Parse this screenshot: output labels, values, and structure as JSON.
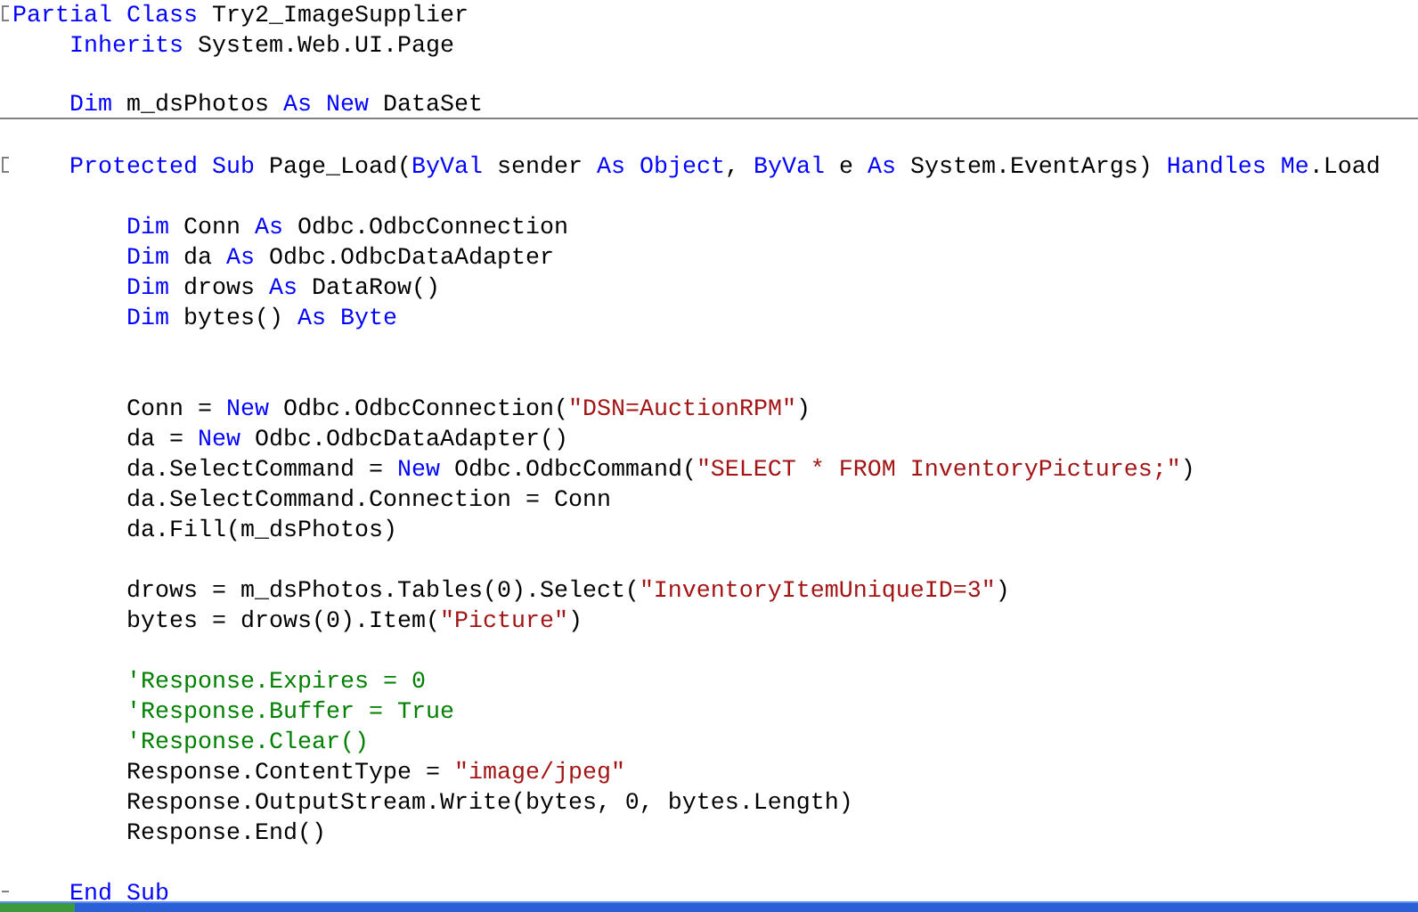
{
  "editor": {
    "lines": [
      {
        "collapsible": true,
        "tokens": [
          {
            "kind": "keyword",
            "text": "Partial Class"
          },
          {
            "kind": "plain",
            "text": " Try2_ImageSupplier"
          }
        ],
        "children": [
          {
            "tokens": [
              {
                "kind": "keyword",
                "text": "Inherits"
              },
              {
                "kind": "plain",
                "text": " System.Web.UI.Page"
              }
            ]
          },
          {
            "blank": true
          },
          {
            "separator_below": true,
            "tokens": [
              {
                "kind": "keyword",
                "text": "Dim"
              },
              {
                "kind": "plain",
                "text": " m_dsPhotos "
              },
              {
                "kind": "keyword",
                "text": "As New"
              },
              {
                "kind": "plain",
                "text": " DataSet"
              }
            ]
          },
          {
            "blank": true
          },
          {
            "collapsible": true,
            "tokens": [
              {
                "kind": "keyword",
                "text": "Protected Sub"
              },
              {
                "kind": "plain",
                "text": " Page_Load("
              },
              {
                "kind": "keyword",
                "text": "ByVal"
              },
              {
                "kind": "plain",
                "text": " sender "
              },
              {
                "kind": "keyword",
                "text": "As Object"
              },
              {
                "kind": "plain",
                "text": ", "
              },
              {
                "kind": "keyword",
                "text": "ByVal"
              },
              {
                "kind": "plain",
                "text": " e "
              },
              {
                "kind": "keyword",
                "text": "As"
              },
              {
                "kind": "plain",
                "text": " System.EventArgs) "
              },
              {
                "kind": "keyword",
                "text": "Handles Me"
              },
              {
                "kind": "plain",
                "text": ".Load"
              }
            ],
            "children": [
              {
                "blank": true
              },
              {
                "tokens": [
                  {
                    "kind": "keyword",
                    "text": "Dim"
                  },
                  {
                    "kind": "plain",
                    "text": " Conn "
                  },
                  {
                    "kind": "keyword",
                    "text": "As"
                  },
                  {
                    "kind": "plain",
                    "text": " Odbc.OdbcConnection"
                  }
                ]
              },
              {
                "tokens": [
                  {
                    "kind": "keyword",
                    "text": "Dim"
                  },
                  {
                    "kind": "plain",
                    "text": " da "
                  },
                  {
                    "kind": "keyword",
                    "text": "As"
                  },
                  {
                    "kind": "plain",
                    "text": " Odbc.OdbcDataAdapter"
                  }
                ]
              },
              {
                "tokens": [
                  {
                    "kind": "keyword",
                    "text": "Dim"
                  },
                  {
                    "kind": "plain",
                    "text": " drows "
                  },
                  {
                    "kind": "keyword",
                    "text": "As"
                  },
                  {
                    "kind": "plain",
                    "text": " DataRow()"
                  }
                ]
              },
              {
                "tokens": [
                  {
                    "kind": "keyword",
                    "text": "Dim"
                  },
                  {
                    "kind": "plain",
                    "text": " bytes() "
                  },
                  {
                    "kind": "keyword",
                    "text": "As Byte"
                  }
                ]
              },
              {
                "blank": true
              },
              {
                "blank": true
              },
              {
                "tokens": [
                  {
                    "kind": "plain",
                    "text": "Conn = "
                  },
                  {
                    "kind": "keyword",
                    "text": "New"
                  },
                  {
                    "kind": "plain",
                    "text": " Odbc.OdbcConnection("
                  },
                  {
                    "kind": "string",
                    "text": "\"DSN=AuctionRPM\""
                  },
                  {
                    "kind": "plain",
                    "text": ")"
                  }
                ]
              },
              {
                "tokens": [
                  {
                    "kind": "plain",
                    "text": "da = "
                  },
                  {
                    "kind": "keyword",
                    "text": "New"
                  },
                  {
                    "kind": "plain",
                    "text": " Odbc.OdbcDataAdapter()"
                  }
                ]
              },
              {
                "tokens": [
                  {
                    "kind": "plain",
                    "text": "da.SelectCommand = "
                  },
                  {
                    "kind": "keyword",
                    "text": "New"
                  },
                  {
                    "kind": "plain",
                    "text": " Odbc.OdbcCommand("
                  },
                  {
                    "kind": "string",
                    "text": "\"SELECT * FROM InventoryPictures;\""
                  },
                  {
                    "kind": "plain",
                    "text": ")"
                  }
                ]
              },
              {
                "tokens": [
                  {
                    "kind": "plain",
                    "text": "da.SelectCommand.Connection = Conn"
                  }
                ]
              },
              {
                "tokens": [
                  {
                    "kind": "plain",
                    "text": "da.Fill(m_dsPhotos)"
                  }
                ]
              },
              {
                "blank": true
              },
              {
                "tokens": [
                  {
                    "kind": "plain",
                    "text": "drows = m_dsPhotos.Tables(0).Select("
                  },
                  {
                    "kind": "string",
                    "text": "\"InventoryItemUniqueID=3\""
                  },
                  {
                    "kind": "plain",
                    "text": ")"
                  }
                ]
              },
              {
                "tokens": [
                  {
                    "kind": "plain",
                    "text": "bytes = drows(0).Item("
                  },
                  {
                    "kind": "string",
                    "text": "\"Picture\""
                  },
                  {
                    "kind": "plain",
                    "text": ")"
                  }
                ]
              },
              {
                "blank": true
              },
              {
                "tokens": [
                  {
                    "kind": "comment",
                    "text": "'Response.Expires = 0"
                  }
                ]
              },
              {
                "tokens": [
                  {
                    "kind": "comment",
                    "text": "'Response.Buffer = True"
                  }
                ]
              },
              {
                "tokens": [
                  {
                    "kind": "comment",
                    "text": "'Response.Clear()"
                  }
                ]
              },
              {
                "tokens": [
                  {
                    "kind": "plain",
                    "text": "Response.ContentType = "
                  },
                  {
                    "kind": "string",
                    "text": "\"image/jpeg\""
                  }
                ]
              },
              {
                "tokens": [
                  {
                    "kind": "plain",
                    "text": "Response.OutputStream.Write(bytes, 0, bytes.Length)"
                  }
                ]
              },
              {
                "tokens": [
                  {
                    "kind": "plain",
                    "text": "Response.End()"
                  }
                ]
              },
              {
                "blank": true
              }
            ]
          },
          {
            "block_end": true,
            "tokens": [
              {
                "kind": "keyword",
                "text": "End Sub"
              }
            ]
          }
        ]
      }
    ]
  }
}
